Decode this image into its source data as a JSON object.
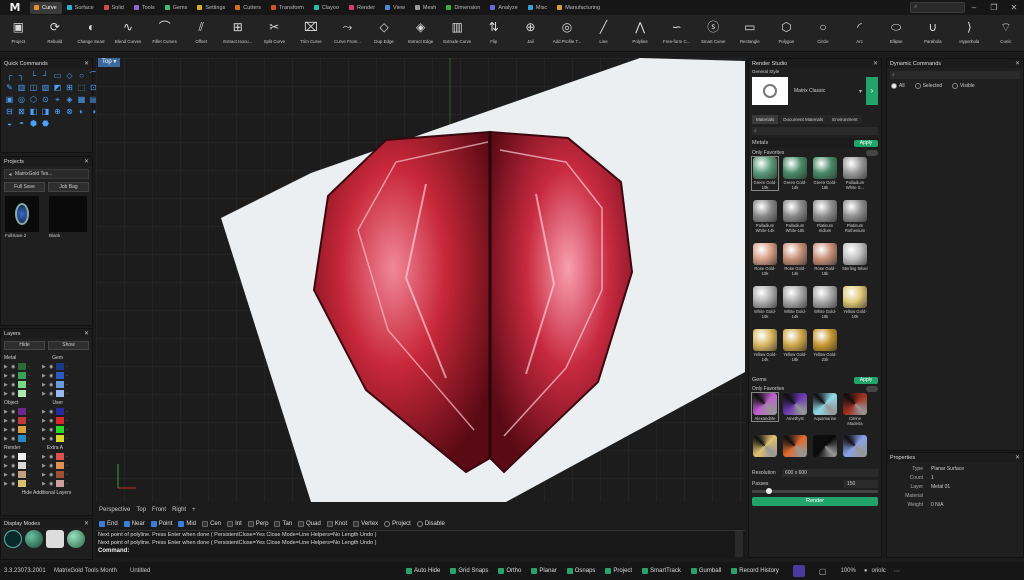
{
  "app": {
    "logo": "M"
  },
  "tabs": [
    {
      "label": "Curve",
      "color": "#e8902a",
      "active": true
    },
    {
      "label": "Surface",
      "color": "#2ab0d8"
    },
    {
      "label": "Solid",
      "color": "#d84a4a"
    },
    {
      "label": "Tools",
      "color": "#8a6ad8"
    },
    {
      "label": "Gems",
      "color": "#3ac07a"
    },
    {
      "label": "Settings",
      "color": "#d8b02a"
    },
    {
      "label": "Cutters",
      "color": "#d86a2a"
    },
    {
      "label": "Transform",
      "color": "#d8502a"
    },
    {
      "label": "Clayoo",
      "color": "#2ac0b0"
    },
    {
      "label": "Render",
      "color": "#d83a6a"
    },
    {
      "label": "View",
      "color": "#4a8ad8"
    },
    {
      "label": "Mesh",
      "color": "#9a9a9a"
    },
    {
      "label": "Dimension",
      "color": "#3ab03a"
    },
    {
      "label": "Analyze",
      "color": "#6a6ad8"
    },
    {
      "label": "Misc",
      "color": "#3aa0d8"
    },
    {
      "label": "Manufacturing",
      "color": "#d8a03a"
    }
  ],
  "ribbon": [
    {
      "label": "Project",
      "icon": "box-icon"
    },
    {
      "label": "Rebuild",
      "icon": "rebuild-icon"
    },
    {
      "label": "Change Seam",
      "icon": "seam-icon"
    },
    {
      "label": "Blend Curves",
      "icon": "blend-icon"
    },
    {
      "label": "Fillet Curves",
      "icon": "fillet-icon"
    },
    {
      "label": "Offset",
      "icon": "offset-icon"
    },
    {
      "label": "Extract Isocu...",
      "icon": "isocurve-icon"
    },
    {
      "label": "Split Curve",
      "icon": "split-icon"
    },
    {
      "label": "Trim Curve",
      "icon": "trim-icon"
    },
    {
      "label": "Curve From...",
      "icon": "curve-from-icon"
    },
    {
      "label": "Dup Edge",
      "icon": "dup-edge-icon"
    },
    {
      "label": "Extract Edge",
      "icon": "extract-edge-icon"
    },
    {
      "label": "Extrude Curve",
      "icon": "extrude-icon"
    },
    {
      "label": "Flip",
      "icon": "flip-icon"
    },
    {
      "label": "Jail",
      "icon": "jail-icon"
    },
    {
      "label": "Add Profile T...",
      "icon": "profile-icon"
    },
    {
      "label": "Line",
      "icon": "line-icon"
    },
    {
      "label": "Polyline",
      "icon": "polyline-icon"
    },
    {
      "label": "Free-form C...",
      "icon": "freeform-icon"
    },
    {
      "label": "Smart Curve",
      "icon": "smart-curve-icon"
    },
    {
      "label": "Rectangle",
      "icon": "rectangle-icon"
    },
    {
      "label": "Polygon",
      "icon": "polygon-icon"
    },
    {
      "label": "Circle",
      "icon": "circle-icon"
    },
    {
      "label": "Arc",
      "icon": "arc-icon"
    },
    {
      "label": "Ellipse",
      "icon": "ellipse-icon"
    },
    {
      "label": "Parabola",
      "icon": "parabola-icon"
    },
    {
      "label": "Hyperbola",
      "icon": "hyperbola-icon"
    },
    {
      "label": "Conic",
      "icon": "conic-icon"
    }
  ],
  "quick_commands": {
    "title": "Quick Commands"
  },
  "projects": {
    "title": "Projects",
    "dropdown": "MatrixGold Tes...",
    "full_save": "Full Save",
    "job_bag": "Job Bag",
    "thumbs": [
      "FullSave 2",
      "Blank"
    ]
  },
  "layers": {
    "title": "Layers",
    "hide": "Hide",
    "show": "Show",
    "groups": [
      {
        "left": "Metal",
        "right": "Gem",
        "lcolors": [
          "#2c6a3a",
          "#3aa05a",
          "#7ad88a",
          "#aee8b0"
        ],
        "rcolors": [
          "#1a3a8a",
          "#2a5ac0",
          "#6a9ae0",
          "#9ab8f0"
        ]
      },
      {
        "left": "Object",
        "right": "User",
        "lcolors": [
          "#6a2a8a",
          "#c03a3a",
          "#d8a040",
          "#2a8ac0"
        ],
        "rcolors": [
          "#2a2aa0",
          "#d82a2a",
          "#2ad82a",
          "#d8d82a"
        ]
      },
      {
        "left": "Render",
        "right": "Extra A",
        "lcolors": [
          "#f0f0f0",
          "#d8d8d8",
          "#c0a080",
          "#d8c070"
        ],
        "rcolors": [
          "#e05050",
          "#e09050",
          "#a05030",
          "#d0a0a0"
        ]
      }
    ],
    "hide_additional": "Hide Additional Layers"
  },
  "display_modes": {
    "title": "Display Modes"
  },
  "viewport": {
    "label": "Top",
    "tabs": [
      "Perspective",
      "Top",
      "Front",
      "Right"
    ]
  },
  "osnaps": [
    {
      "label": "End",
      "on": true
    },
    {
      "label": "Near",
      "on": true
    },
    {
      "label": "Point",
      "on": true
    },
    {
      "label": "Mid",
      "on": true
    },
    {
      "label": "Cen",
      "on": false
    },
    {
      "label": "Int",
      "on": false
    },
    {
      "label": "Perp",
      "on": false
    },
    {
      "label": "Tan",
      "on": false
    },
    {
      "label": "Quad",
      "on": false
    },
    {
      "label": "Knot",
      "on": false
    },
    {
      "label": "Vertex",
      "on": false
    }
  ],
  "osnap_radios": [
    "Project",
    "Disable"
  ],
  "command": {
    "history": [
      "Next point of polyline. Press Enter when done ( PersistentClose=Yes  Close  Mode=Line  Helpers=No  Length  Undo )",
      "Next point of polyline. Press Enter when done ( PersistentClose=Yes  Close  Mode=Line  Helpers=No  Length  Undo )"
    ],
    "prompt": "Command:"
  },
  "render_studio": {
    "title": "Render Studio",
    "general_style": "General Style",
    "style_name": "Matrix Classic",
    "subtabs": [
      "Materials",
      "Document Materials",
      "Environment"
    ],
    "metals_title": "Metals",
    "apply": "Apply",
    "only_favorites": "Only Favorites",
    "metals": [
      {
        "name": "Green Gold-10k",
        "color": "#5a9a7a"
      },
      {
        "name": "Green Gold-14k",
        "color": "#4a8a68"
      },
      {
        "name": "Green Gold-18k",
        "color": "#4a8a68"
      },
      {
        "name": "Palladium White S...",
        "color": "#9a9a9a"
      },
      {
        "name": "Palladium White-14k",
        "color": "#8a8a8a"
      },
      {
        "name": "Palladium White-18k",
        "color": "#8a8a8a"
      },
      {
        "name": "Platinum Iridium",
        "color": "#909090"
      },
      {
        "name": "Platinum Ruthenium",
        "color": "#909090"
      },
      {
        "name": "Rose Gold-10k",
        "color": "#d8a088"
      },
      {
        "name": "Rose Gold-14k",
        "color": "#c89078"
      },
      {
        "name": "Rose Gold-18k",
        "color": "#c89078"
      },
      {
        "name": "Sterling Silver",
        "color": "#c0c0c0"
      },
      {
        "name": "White Gold-10k",
        "color": "#b0b0b0"
      },
      {
        "name": "White Gold-14k",
        "color": "#a8a8a8"
      },
      {
        "name": "White Gold-18k",
        "color": "#a8a8a8"
      },
      {
        "name": "Yellow Gold-10k",
        "color": "#e0c878"
      },
      {
        "name": "Yellow Gold-14k",
        "color": "#d8b860"
      },
      {
        "name": "Yellow Gold-18k",
        "color": "#d0a848"
      },
      {
        "name": "Yellow Gold-22k",
        "color": "#c89830"
      }
    ],
    "gems_title": "Gems",
    "gems": [
      {
        "name": "Alexandrite",
        "color": "#c060d0"
      },
      {
        "name": "Amethyst",
        "color": "#6a3ab0"
      },
      {
        "name": "Aquamarine",
        "color": "#90d8e8"
      },
      {
        "name": "Citrine Madeira",
        "color": "#a03020"
      },
      {
        "name": "",
        "color": "#e0c070"
      },
      {
        "name": "",
        "color": "#e06a30"
      },
      {
        "name": "",
        "color": "#0a0a0a"
      },
      {
        "name": "",
        "color": "#8aa0e8"
      }
    ],
    "resolution_label": "Resolution",
    "resolution_value": "600 x 600",
    "passes_label": "Passes",
    "passes_value": "150",
    "render_button": "Render"
  },
  "dynamic_commands": {
    "title": "Dynamic Commands",
    "radios": [
      "All",
      "Selected",
      "Visible"
    ]
  },
  "properties": {
    "title": "Properties",
    "rows": [
      {
        "k": "Type",
        "v": "Planar Surface"
      },
      {
        "k": "Count",
        "v": "1"
      },
      {
        "k": "Layer",
        "v": "Metal 01"
      },
      {
        "k": "Material",
        "v": ""
      },
      {
        "k": "Weight",
        "v": "0 N/A"
      }
    ]
  },
  "status": {
    "version": "3.3.23073.2001",
    "product": "MatrixGold Tools Month",
    "file": "Untitled",
    "toggles": [
      "Auto Hide",
      "Grid Snaps",
      "Ortho",
      "Planar",
      "Osnaps",
      "Project",
      "SmartTrack",
      "Gumball",
      "Record History"
    ],
    "zoom": "100%",
    "user": "oriolc"
  }
}
